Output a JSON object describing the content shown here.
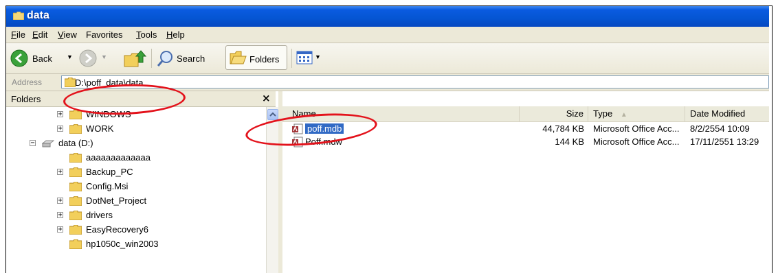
{
  "window": {
    "title": "data"
  },
  "menu": [
    {
      "key": "F",
      "rest": "ile"
    },
    {
      "key": "E",
      "rest": "dit"
    },
    {
      "key": "V",
      "rest": "iew"
    },
    {
      "key": "",
      "rest": "Favorites"
    },
    {
      "key": "T",
      "rest": "ools"
    },
    {
      "key": "H",
      "rest": "elp"
    }
  ],
  "toolbar": {
    "back_label": "Back",
    "search_label": "Search",
    "folders_label": "Folders"
  },
  "address": {
    "label": "Address",
    "value": "D:\\poff_data\\data"
  },
  "folders_pane": {
    "title": "Folders",
    "close_symbol": "×",
    "items": [
      {
        "label": "WINDOWS",
        "expander": "+"
      },
      {
        "label": "WORK",
        "expander": "+"
      },
      {
        "label": "data (D:)",
        "expander": "−"
      },
      {
        "label": "aaaaaaaaaaaaa",
        "expander": ""
      },
      {
        "label": "Backup_PC",
        "expander": "+"
      },
      {
        "label": "Config.Msi",
        "expander": ""
      },
      {
        "label": "DotNet_Project",
        "expander": "+"
      },
      {
        "label": "drivers",
        "expander": "+"
      },
      {
        "label": "EasyRecovery6",
        "expander": "+"
      },
      {
        "label": "hp1050c_win2003",
        "expander": ""
      }
    ]
  },
  "file_list": {
    "columns": [
      "Name",
      "Size",
      "Type",
      "Date Modified"
    ],
    "sort_indicator": "▲",
    "rows": [
      {
        "name": "poff.mdb",
        "size": "44,784 KB",
        "type": "Microsoft Office Acc...",
        "date": "8/2/2554 10:09",
        "selected": true
      },
      {
        "name": "Poff.mdw",
        "size": "144 KB",
        "type": "Microsoft Office Acc...",
        "date": "17/11/2551 13:29",
        "selected": false
      }
    ]
  },
  "colors": {
    "titlebar": "#0556d4",
    "selection": "#316ac5",
    "annotation": "#e3121b",
    "chrome": "#ece9d8"
  }
}
